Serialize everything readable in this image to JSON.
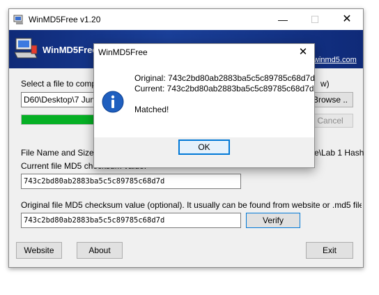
{
  "window": {
    "title": "WinMD5Free v1.20",
    "controls": {
      "minimize": "—",
      "maximize": "☐",
      "close": "✕"
    }
  },
  "banner": {
    "title": "WinMD5Free",
    "link": "winmd5.com"
  },
  "main": {
    "select_label": "Select a file to comp",
    "select_label_tail": "w)",
    "file_path": "D60\\Desktop\\7 June",
    "browse_label": "Browse ..",
    "cancel_label": "Cancel",
    "progress_percent": 100,
    "file_name_label": "File Name and Size:",
    "file_name_tail": "e\\Lab 1  Hash",
    "current_md5_label": "Current file MD5 checksum value:",
    "current_md5": "743c2bd80ab2883ba5c5c89785c68d7d",
    "original_md5_label": "Original file MD5 checksum value (optional). It usually can be found from website or .md5 file",
    "original_md5": "743c2bd80ab2883ba5c5c89785c68d7d",
    "verify_label": "Verify"
  },
  "footer": {
    "website_label": "Website",
    "about_label": "About",
    "exit_label": "Exit"
  },
  "dialog": {
    "title": "WinMD5Free",
    "close": "✕",
    "original_line": "Original: 743c2bd80ab2883ba5c5c89785c68d7d",
    "current_line": "Current: 743c2bd80ab2883ba5c5c89785c68d7d",
    "result": "Matched!",
    "ok_label": "OK"
  },
  "colors": {
    "banner": "#1a3f98",
    "progress": "#06b025",
    "info_icon": "#1f5fbf",
    "focus": "#0078d7"
  }
}
